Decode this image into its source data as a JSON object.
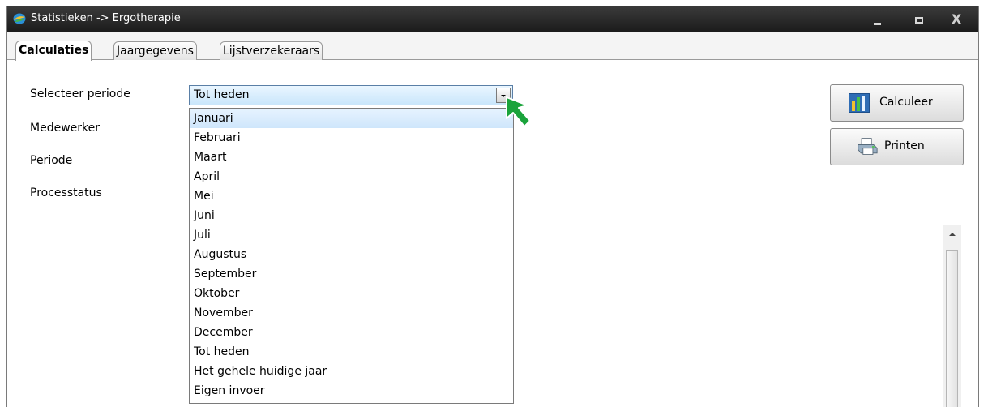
{
  "window": {
    "title": "Statistieken -> Ergotherapie"
  },
  "tabs": [
    {
      "label": "Calculaties",
      "active": true
    },
    {
      "label": "Jaargegevens",
      "active": false
    },
    {
      "label": "Lijstverzekeraars",
      "active": false
    }
  ],
  "form": {
    "select_period_label": "Selecteer periode",
    "employee_label": "Medewerker",
    "period_label": "Periode",
    "process_status_label": "Processtatus"
  },
  "period_select": {
    "selected": "Tot heden",
    "highlighted_option": "Januari",
    "options": [
      "Januari",
      "Februari",
      "Maart",
      "April",
      "Mei",
      "Juni",
      "Juli",
      "Augustus",
      "September",
      "Oktober",
      "November",
      "December",
      "Tot heden",
      "Het gehele huidige jaar",
      "Eigen invoer"
    ]
  },
  "buttons": {
    "calculate_label": "Calculeer",
    "print_label": "Printen"
  },
  "icons": {
    "app": "app-logo-icon",
    "calculate": "bar-chart-icon",
    "print": "printer-icon",
    "pointer": "green-arrow-cursor-icon"
  },
  "colors": {
    "titlebar": "#1b1b1b",
    "combo_fill": "#c9e6fb",
    "selected_option": "#cfe6fb",
    "cursor": "#1aa33b"
  }
}
